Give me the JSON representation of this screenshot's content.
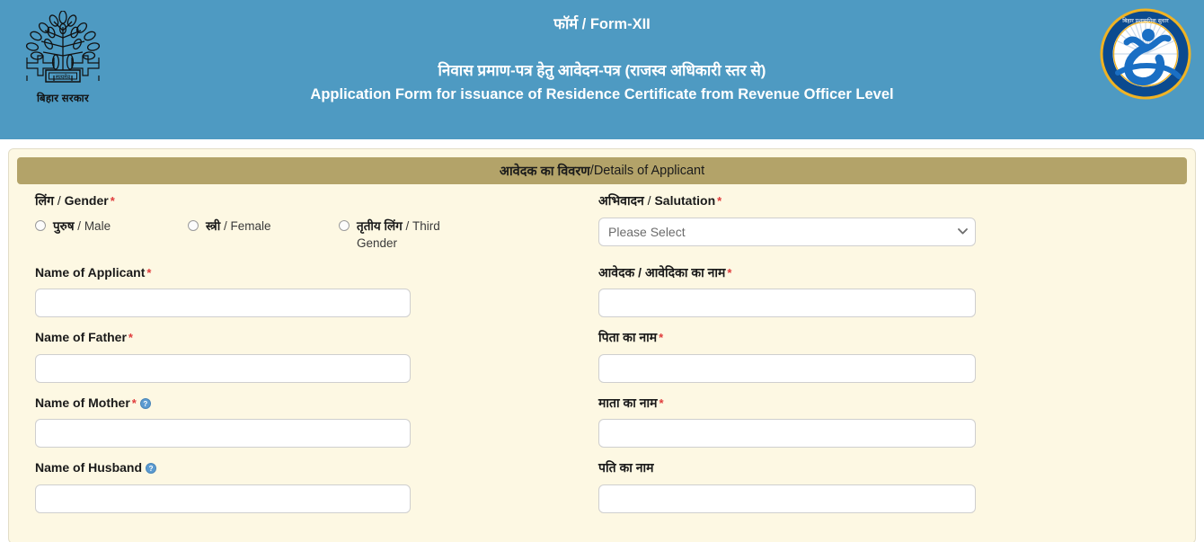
{
  "header": {
    "emblem_caption": "बिहार सरकार",
    "emblem_name": "bihar-government-emblem",
    "form_title": "फॉर्म / Form-XII",
    "subtitle_hi": "निवास प्रमाण-पत्र हेतु आवेदन-पत्र (राजस्व अधिकारी स्तर से)",
    "subtitle_en": "Application Form for issuance of  Residence Certificate from Revenue Officer Level",
    "brand_logo_text": "बिहार प्रशासनिक सुधार मिशन",
    "background_color": "#4e9ac2"
  },
  "section": {
    "title_hi": "आवेदक का विवरण",
    "title_sep": " / ",
    "title_en": "Details of Applicant",
    "bar_color": "#b3a369"
  },
  "form": {
    "gender": {
      "label_hi": "लिंग",
      "label_sep": " / ",
      "label_en": "Gender",
      "required": "*",
      "options": [
        {
          "hi": "पुरुष",
          "sep": " / ",
          "en": "Male",
          "selected": false
        },
        {
          "hi": "स्त्री",
          "sep": " / ",
          "en": "Female",
          "selected": false
        },
        {
          "hi": "तृतीय लिंग",
          "sep": " / ",
          "en": "Third Gender",
          "selected": false
        }
      ]
    },
    "salutation": {
      "label_hi": "अभिवादन",
      "label_sep": " / ",
      "label_en": "Salutation",
      "required": "*",
      "selected_value": "Please Select"
    },
    "applicant_name": {
      "label_en": "Name of Applicant",
      "required": "*",
      "value": "",
      "label_hi": "आवेदक / आवेदिका का नाम",
      "required_hi": "*",
      "value_hi": ""
    },
    "father_name": {
      "label_en": "Name of Father",
      "required": "*",
      "value": "",
      "label_hi": "पिता का नाम",
      "required_hi": "*",
      "value_hi": ""
    },
    "mother_name": {
      "label_en": "Name of Mother",
      "required": "*",
      "help": "?",
      "value": "",
      "label_hi": "माता का नाम",
      "required_hi": "*",
      "value_hi": ""
    },
    "husband_name": {
      "label_en": "Name of Husband",
      "help": "?",
      "value": "",
      "label_hi": "पति का नाम",
      "value_hi": ""
    }
  },
  "colors": {
    "header_blue": "#4e9ac2",
    "panel_cream": "#fdf8e3",
    "section_tan": "#b3a369",
    "required_red": "#e03c3c",
    "help_blue": "#5b9bd1"
  }
}
